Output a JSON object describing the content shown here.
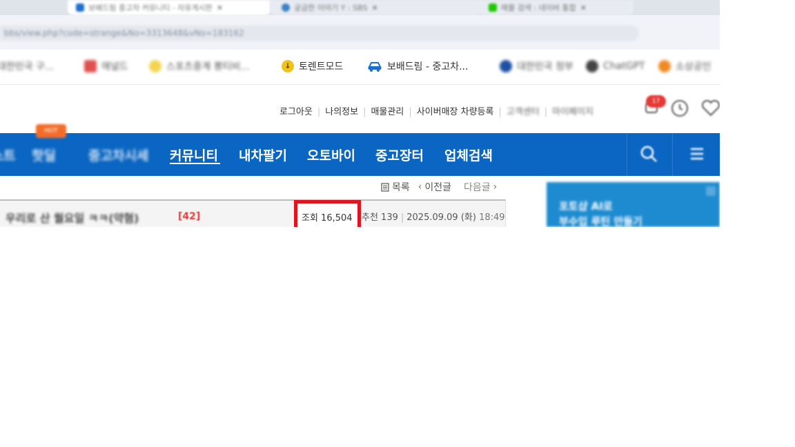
{
  "browser": {
    "tabs": [
      {
        "label": "보배드림 중고차 커뮤니티 - 자유게시판"
      },
      {
        "label": "궁금한 이야기 Y : SBS"
      },
      {
        "label": "매물 검색 : 네이버 통합"
      }
    ],
    "url": "bbs/view.php?code=strange&No=3313648&vNo=183162"
  },
  "bookmarks": [
    {
      "label": "대한민국 구...",
      "icon": "bookmark-icon",
      "blurred": true
    },
    {
      "label": "애널드",
      "icon": "grid-icon",
      "blurred": true
    },
    {
      "label": "스포츠중계 뽕티비...",
      "icon": "star-icon",
      "blurred": true
    },
    {
      "label": "토렌트모드",
      "icon": "torrent-icon",
      "blurred": false
    },
    {
      "label": "보배드림 - 중고차...",
      "icon": "car-icon",
      "blurred": false
    },
    {
      "label": "대한민국 정부",
      "icon": "gov-icon",
      "blurred": true
    },
    {
      "label": "ChatGPT",
      "icon": "chatgpt-icon",
      "blurred": true
    },
    {
      "label": "소상공인",
      "icon": "pinwheel-icon",
      "blurred": true
    }
  ],
  "util_links": {
    "clear": [
      "로그아웃",
      "나의정보",
      "매물관리",
      "사이버매장 차량등록"
    ],
    "blurred": [
      "고객센터",
      "마이페이지"
    ]
  },
  "notification_badge": "17",
  "nav": {
    "hot_badge": "HOT",
    "items": [
      "베스트",
      "핫딜",
      "중고차시세",
      "커뮤니티",
      "내차팔기",
      "오토바이",
      "중고장터",
      "업체검색"
    ],
    "active": "커뮤니티"
  },
  "article_nav": {
    "list": "목록",
    "prev": "이전글",
    "next": "다음글"
  },
  "post": {
    "title": "우리로 산 월요일 ㅋㅋ(약혐)",
    "comment_count": "[42]",
    "views_label": "조회 16,504",
    "recommend_label": "추천 139",
    "date": "2025.09.09 (화)",
    "time": "18:49"
  },
  "ad": {
    "line1": "포토샵 AI로",
    "line2": "부수입 루틴 만들기"
  },
  "colors": {
    "nav_blue": "#0a66c2",
    "highlight_red": "#e0141e",
    "comment_red": "#e53935",
    "hot_orange": "#f36c2a"
  }
}
